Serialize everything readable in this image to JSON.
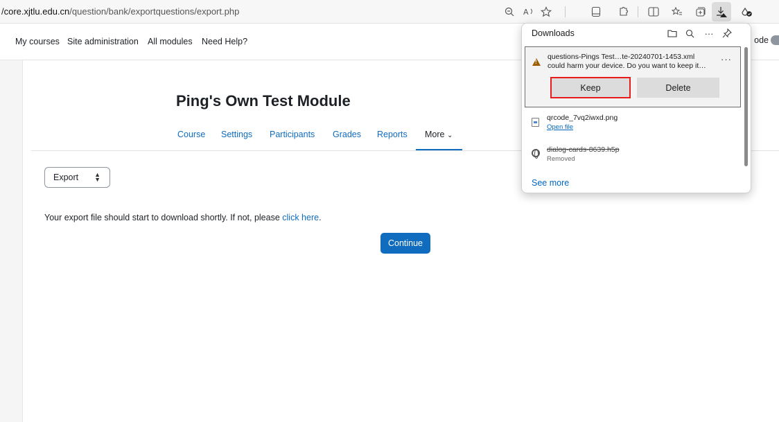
{
  "browser": {
    "url_host": "core.xjtlu.edu.cn",
    "url_path": "/question/bank/exportquestions/export.php",
    "url_prefix": "/"
  },
  "navbar": {
    "items": [
      "My courses",
      "Site administration",
      "All modules",
      "Need Help?"
    ],
    "edit_mode_label": "ode"
  },
  "course": {
    "title": "Ping's Own Test Module",
    "tabs": [
      "Course",
      "Settings",
      "Participants",
      "Grades",
      "Reports",
      "More"
    ],
    "more_caret": "⌄"
  },
  "page": {
    "select_value": "Export",
    "message_text": "Your export file should start to download shortly. If not, please ",
    "message_link": "click here",
    "message_end": ".",
    "continue_label": "Continue"
  },
  "downloads": {
    "title": "Downloads",
    "warn_item": {
      "name": "questions-Pings Test…te-20240701-1453.xml",
      "description": "could harm your device. Do you want to keep it…",
      "more": "···",
      "keep_label": "Keep",
      "delete_label": "Delete"
    },
    "items": [
      {
        "name": "qrcode_7vq2iwxd.png",
        "sub": "Open file"
      },
      {
        "name": "dialog-cards-8639.h5p",
        "sub": "Removed"
      }
    ],
    "see_more": "See more"
  },
  "icons": {
    "zoom": "zoom-out-icon",
    "read_aloud": "read-aloud-icon",
    "favorite": "favorite-star-icon",
    "downloads": "downloads-icon"
  }
}
